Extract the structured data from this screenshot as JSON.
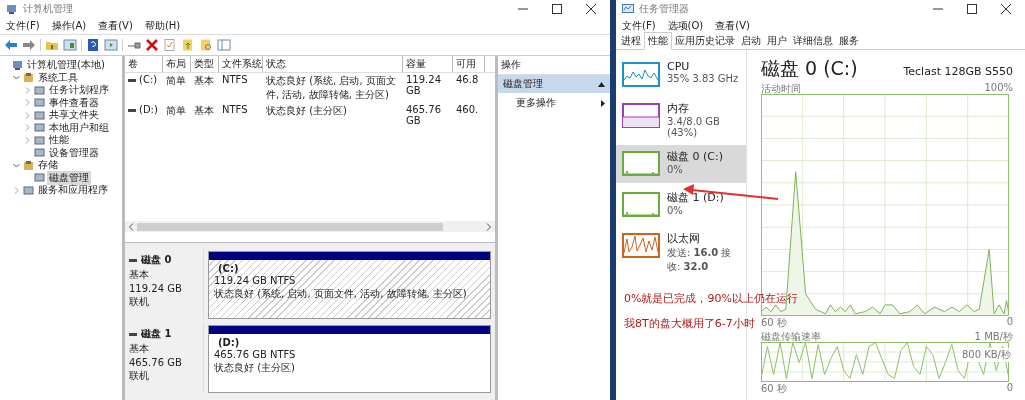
{
  "disk_mgmt_window": {
    "title": "计算机管理",
    "menu": [
      "文件(F)",
      "操作(A)",
      "查看(V)",
      "帮助(H)"
    ],
    "tree": [
      {
        "label": "计算机管理(本地)",
        "selected": false,
        "children": [
          {
            "label": "系统工具",
            "expanded": true,
            "selected": false,
            "children": [
              {
                "label": "任务计划程序",
                "expanded": false,
                "selected": false
              },
              {
                "label": "事件查看器",
                "expanded": false,
                "selected": false
              },
              {
                "label": "共享文件夹",
                "expanded": false,
                "selected": false
              },
              {
                "label": "本地用户和组",
                "expanded": false,
                "selected": false
              },
              {
                "label": "性能",
                "expanded": false,
                "selected": false
              },
              {
                "label": "设备管理器",
                "selected": false
              }
            ]
          },
          {
            "label": "存储",
            "expanded": true,
            "selected": false,
            "children": [
              {
                "label": "磁盘管理",
                "selected": true
              }
            ]
          },
          {
            "label": "服务和应用程序",
            "expanded": false,
            "selected": false
          }
        ]
      }
    ],
    "volumes": {
      "columns": [
        "卷",
        "布局",
        "类型",
        "文件系统",
        "状态",
        "容量",
        "可用"
      ],
      "rows": [
        [
          "(C:)",
          "简单",
          "基本",
          "NTFS",
          "状态良好 (系统, 启动, 页面文件, 活动, 故障转储, 主分区)",
          "119.24 GB",
          "46.8"
        ],
        [
          "(D:)",
          "简单",
          "基本",
          "NTFS",
          "状态良好 (主分区)",
          "465.76 GB",
          "460."
        ]
      ]
    },
    "actions": {
      "header": "操作",
      "items": [
        {
          "label": "磁盘管理",
          "kind": "section"
        },
        {
          "label": "更多操作",
          "kind": "submenu"
        }
      ]
    },
    "disks": [
      {
        "name": "磁盘 0",
        "type": "基本",
        "size": "119.24 GB",
        "status": "联机",
        "partitions": [
          {
            "label": "(C:)",
            "size": "119.24 GB NTFS",
            "status": "状态良好 (系统, 启动, 页面文件, 活动, 故障转储, 主分区)",
            "selected": true
          }
        ]
      },
      {
        "name": "磁盘 1",
        "type": "基本",
        "size": "465.76 GB",
        "status": "联机",
        "partitions": [
          {
            "label": "(D:)",
            "size": "465.76 GB NTFS",
            "status": "状态良好 (主分区)",
            "selected": false
          }
        ]
      }
    ]
  },
  "task_manager": {
    "title": "任务管理器",
    "menu": [
      "文件(F)",
      "选项(O)",
      "查看(V)"
    ],
    "tabs": [
      {
        "label": "进程",
        "selected": false
      },
      {
        "label": "性能",
        "selected": true
      },
      {
        "label": "应用历史记录",
        "selected": false
      },
      {
        "label": "启动",
        "selected": false
      },
      {
        "label": "用户",
        "selected": false
      },
      {
        "label": "详细信息",
        "selected": false
      },
      {
        "label": "服务",
        "selected": false
      }
    ],
    "sidebar": [
      {
        "kind": "cpu",
        "name": "CPU",
        "value": "35%  3.83 GHz",
        "color": "#1c8fd0",
        "selected": false
      },
      {
        "kind": "memory",
        "name": "内存",
        "value": "3.4/8.0 GB (43%)",
        "color": "#9b3fb5",
        "selected": false
      },
      {
        "kind": "disk",
        "name": "磁盘 0 (C:)",
        "value": "0%",
        "color": "#6aac3c",
        "selected": true
      },
      {
        "kind": "disk",
        "name": "磁盘 1 (D:)",
        "value": "0%",
        "color": "#6aac3c",
        "selected": false
      },
      {
        "kind": "network",
        "name": "以太网",
        "value": "发送: **16.0** 接收: **32.0**",
        "color": "#c9661b",
        "selected": false
      }
    ],
    "detail": {
      "title": "磁盘 0 (C:)",
      "model": "Teclast 128GB S550",
      "activity_label": "活动时间",
      "activity_max": "100%",
      "activity_span": "60 秒",
      "activity_min": "0",
      "transfer_label": "磁盘传输速率",
      "transfer_max": "1 MB/秒",
      "transfer_mid": "800 KB/秒",
      "transfer_span": "60 秒",
      "transfer_min": "0"
    }
  },
  "annotations": [
    "0%就是已完成，90%以上仍在运行",
    "我8T的盘大概用了6-7小时"
  ]
}
